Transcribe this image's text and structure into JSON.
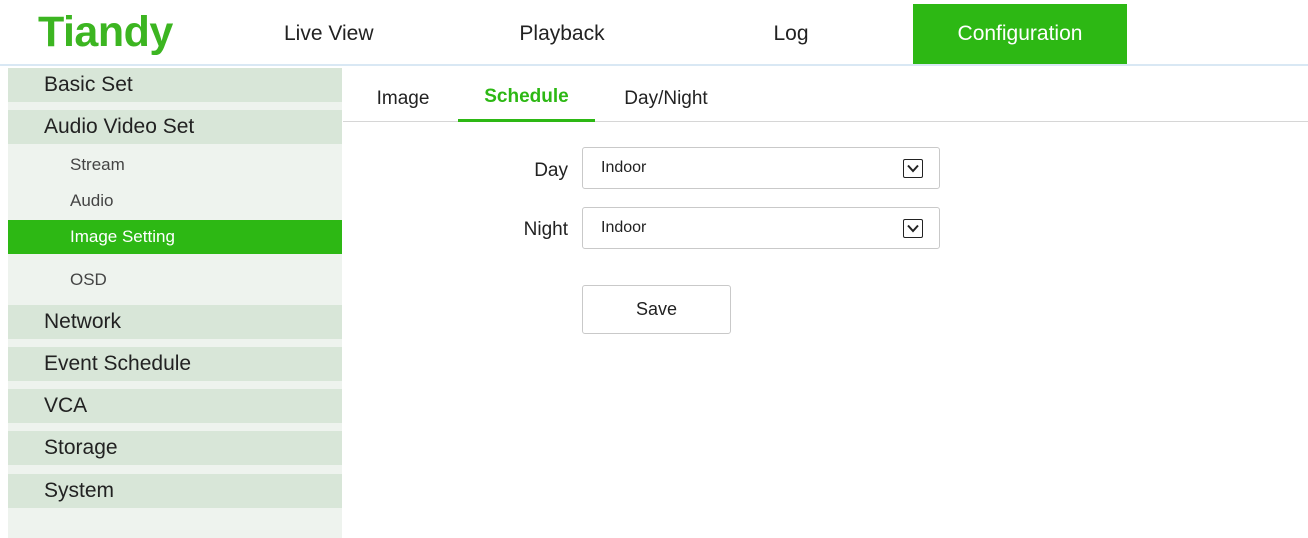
{
  "brand": {
    "logo_text": "Tiandy",
    "accent_color": "#2db814",
    "logo_color": "#3cb521"
  },
  "nav": {
    "items": [
      {
        "label": "Live View"
      },
      {
        "label": "Playback"
      },
      {
        "label": "Log"
      },
      {
        "label": "Configuration",
        "active": true
      }
    ]
  },
  "sidebar": {
    "groups": [
      {
        "label": "Basic Set"
      },
      {
        "label": "Audio Video Set",
        "children": [
          {
            "label": "Stream"
          },
          {
            "label": "Audio"
          },
          {
            "label": "Image Setting",
            "active": true
          },
          {
            "label": "OSD"
          }
        ]
      },
      {
        "label": "Network"
      },
      {
        "label": "Event Schedule"
      },
      {
        "label": "VCA"
      },
      {
        "label": "Storage"
      },
      {
        "label": "System"
      }
    ]
  },
  "tabs": {
    "items": [
      {
        "label": "Image"
      },
      {
        "label": "Schedule",
        "active": true
      },
      {
        "label": "Day/Night"
      }
    ]
  },
  "form": {
    "day": {
      "label": "Day",
      "value": "Indoor"
    },
    "night": {
      "label": "Night",
      "value": "Indoor"
    },
    "save_label": "Save"
  }
}
